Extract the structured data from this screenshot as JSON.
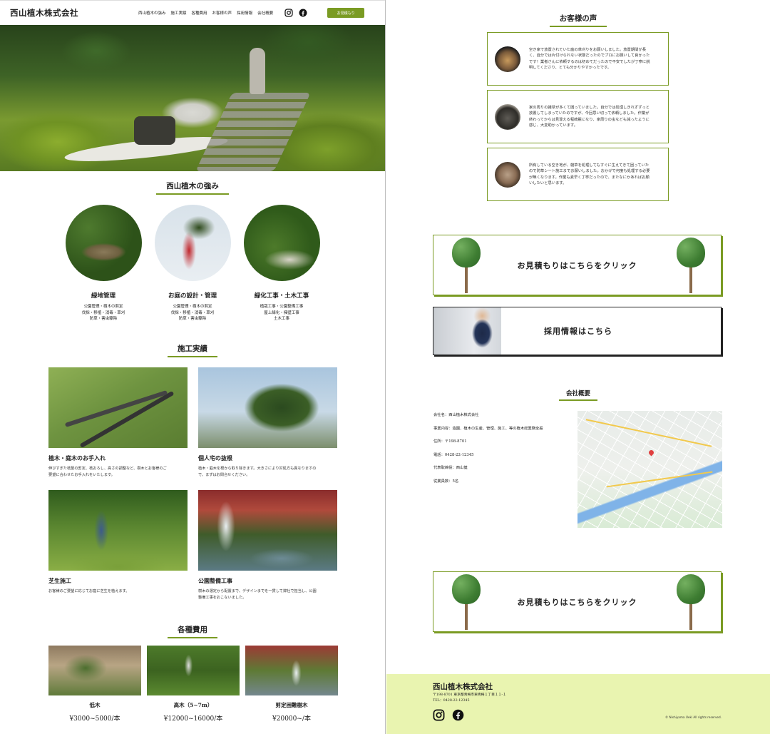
{
  "header": {
    "logo": "西山植木株式会社",
    "nav": [
      "西山植木の強み",
      "施工実績",
      "各種費用",
      "お客様の声",
      "採用情報",
      "会社概要"
    ],
    "icons": [
      "instagram-icon",
      "facebook-icon"
    ],
    "cta_label": "お見積もり"
  },
  "strengths": {
    "title": "西山植木の強み",
    "items": [
      {
        "title": "緑地管理",
        "desc": "公園管理・樹木の剪定\n伐採・移植・消毒・草刈\n防草・害虫駆除"
      },
      {
        "title": "お庭の設計・管理",
        "desc": "公園管理・樹木の剪定\n伐採・移植・消毒・草刈\n防草・害虫駆除"
      },
      {
        "title": "緑化工事・土木工事",
        "desc": "植栽工事・公園整備工事\n屋上緑化・擁壁工事\n土木工事"
      }
    ]
  },
  "works": {
    "title": "施工実績",
    "items": [
      {
        "title": "植木・庭木のお手入れ",
        "desc": "伸びすぎた枝葉の剪定、枝おろし、高さの調整など、樹木とお客様のご\n要望に合わせたお手入れをいたします。"
      },
      {
        "title": "個人宅の抜根",
        "desc": "植木・庭木を根から取り除きます。大きさにより対処方も異なりますの\nで、まずはお問合せください。"
      },
      {
        "title": "芝生施工",
        "desc": "お客様のご要望に応じてお庭に芝生を植えます。"
      },
      {
        "title": "公園整備工事",
        "desc": "樹木の選定から配置まで、デザインまでを一貫して弊社で担当し、公園\n整備工事をおこないました。"
      }
    ]
  },
  "prices": {
    "title": "各種費用",
    "items": [
      {
        "name": "低木",
        "value": "¥3000~5000/本"
      },
      {
        "name": "高木（5~7m）",
        "value": "¥12000~16000/本"
      },
      {
        "name": "剪定困難樹木",
        "value": "¥20000~/本"
      }
    ]
  },
  "voices": {
    "title": "お客様の声",
    "items": [
      {
        "avatar": "dog-avatar",
        "text": "空き家で放置されていた庭の草刈りをお願いしました。放置期間が長\nく、自分では片付けられない状態だったのでプロにお願いして良かった\nです！業者さんに依頼するのは初めてだったので不安でしたが丁寧に説\n明してくださり、とても分かりやすかったです。"
      },
      {
        "avatar": "gorilla-avatar",
        "text": "家の周りの雑草が多くて困っていました。自分では処理しきれずずっと\n放置してしまっていたのですが、今回思い切って依頼しました。作業が\n終わってからは見違える程綺麗になり、家周りの虫なども減ったように\n感じ、大変助かっています。"
      },
      {
        "avatar": "cat-avatar",
        "text": "所有している空き地が、雑草を処理してもすぐに生えてきて困っていた\nので防草シート施工までお願いしました。おかげで何度も処理する必要\nが無くなります。作業も素早く丁寧だったので、またなにかあればお願\nいしたいと思います。"
      }
    ]
  },
  "cta": {
    "label": "お見積もりはこちらをクリック"
  },
  "recruit": {
    "label": "採用情報はこちら"
  },
  "company": {
    "title": "会社概要",
    "rows": [
      "会社名：西山植木株式会社",
      "事業内容：造園、植木の生産、管理、施工、等の植木総業務全般",
      "住所：〒198-8701",
      "電話：0428-22-12345",
      "代表取締役：西山健",
      "従業員数：5名"
    ]
  },
  "footer": {
    "logo": "西山植木株式会社",
    "address": "〒198-8701 東京都青梅市東青梅１丁目１１-１\nTEL：0428-22-12345",
    "copyright": "© Nishiyama Ueki  All rights reserved."
  },
  "colors": {
    "accent": "#7a9b23",
    "footer_bg": "#e9f4b0"
  }
}
